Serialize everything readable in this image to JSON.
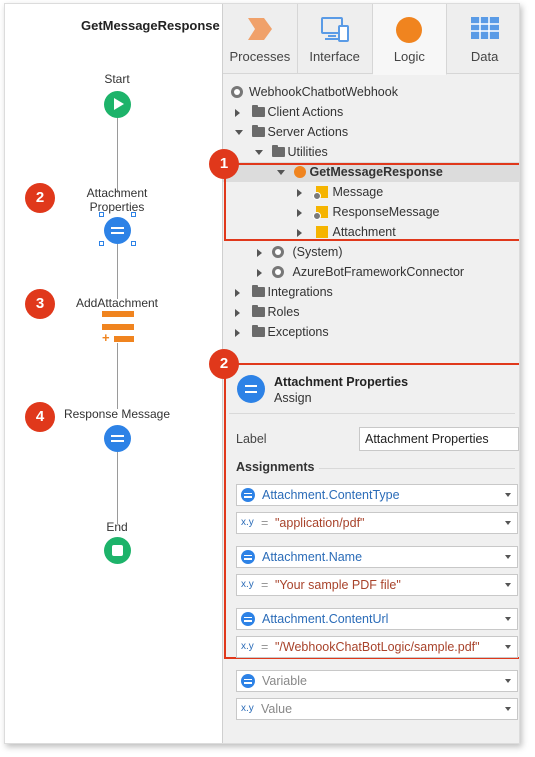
{
  "flow": {
    "title": "GetMessageResponse",
    "nodes": {
      "start": "Start",
      "attachment_properties": "Attachment Properties",
      "add_attachment": "AddAttachment",
      "response_message": "Response Message",
      "end": "End"
    },
    "badges": [
      "2",
      "3",
      "4"
    ]
  },
  "tabs": [
    {
      "label": "Processes",
      "icon": "processes-icon"
    },
    {
      "label": "Interface",
      "icon": "interface-icon"
    },
    {
      "label": "Logic",
      "icon": "logic-icon",
      "active": true
    },
    {
      "label": "Data",
      "icon": "data-icon"
    }
  ],
  "tree": {
    "root": "WebhookChatbotWebhook",
    "client_actions": "Client Actions",
    "server_actions": "Server Actions",
    "utilities": "Utilities",
    "selected_action": "GetMessageResponse",
    "params": [
      "Message",
      "ResponseMessage",
      "Attachment"
    ],
    "system": "(System)",
    "azure": "AzureBotFrameworkConnector",
    "integrations": "Integrations",
    "roles": "Roles",
    "exceptions": "Exceptions"
  },
  "callouts": {
    "tree_badge": "1",
    "props_badge": "2"
  },
  "properties": {
    "title": "Attachment Properties",
    "subtitle": "Assign",
    "label_caption": "Label",
    "label_value": "Attachment Properties",
    "assignments_heading": "Assignments",
    "assignments": [
      {
        "variable": "Attachment.ContentType",
        "value": "\"application/pdf\""
      },
      {
        "variable": "Attachment.Name",
        "value": "\"Your sample PDF file\""
      },
      {
        "variable": "Attachment.ContentUrl",
        "value": "\"/WebhookChatBotLogic/sample.pdf\""
      }
    ],
    "empty_variable_placeholder": "Variable",
    "empty_value_placeholder": "Value",
    "xy_label": "x.y",
    "equals": "="
  },
  "colors": {
    "accent_blue": "#2d82e6",
    "start_end_green": "#1db36a",
    "callout_red": "#e0381b",
    "logic_orange": "#f0841f"
  }
}
